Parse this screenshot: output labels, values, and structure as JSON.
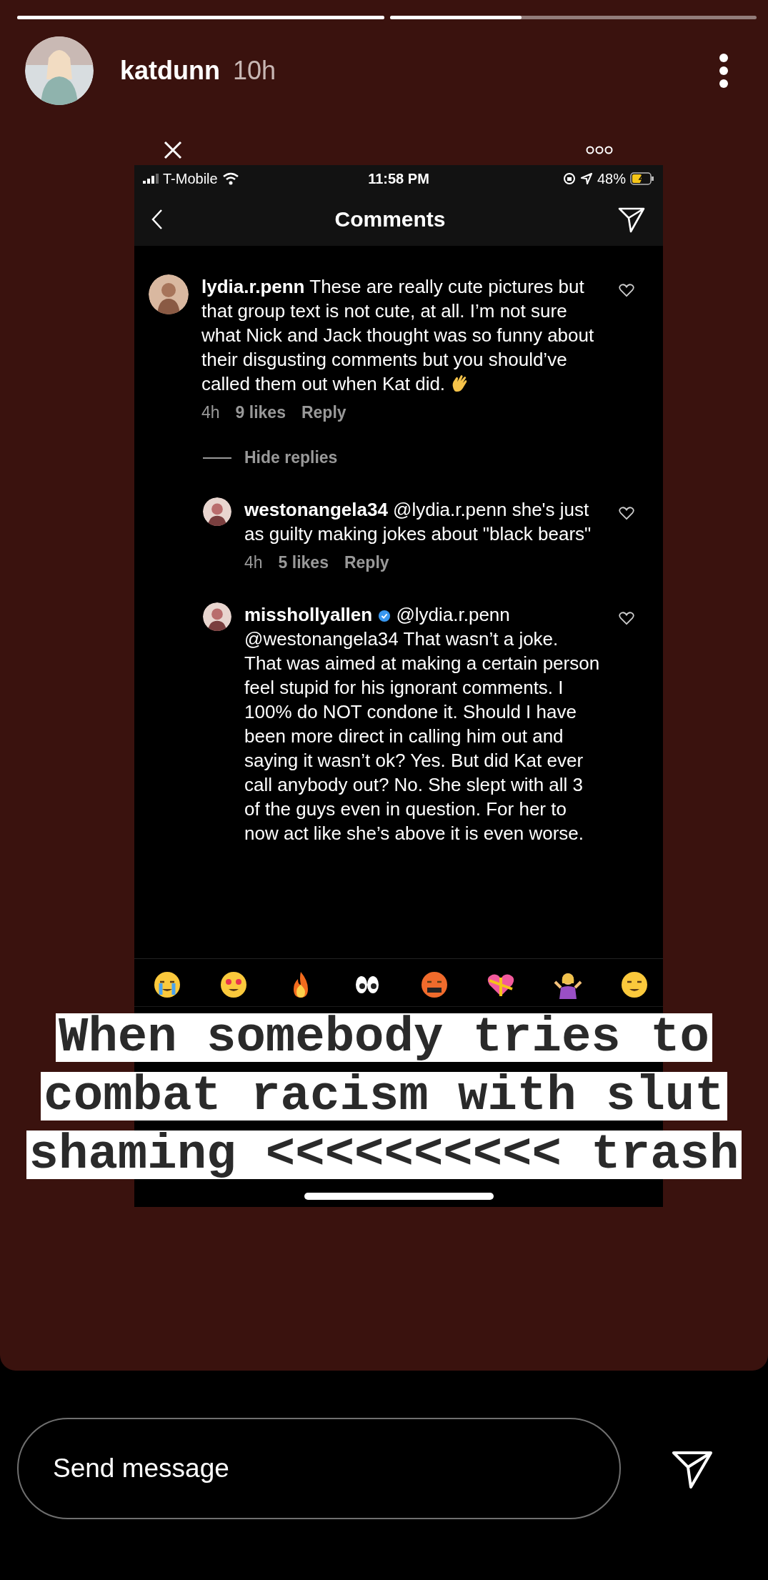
{
  "progress": [
    {
      "level": 1
    },
    {
      "level": 0.36
    }
  ],
  "header": {
    "username": "katdunn",
    "time": "10h"
  },
  "screenshot": {
    "status_bar": {
      "carrier": "T-Mobile",
      "time": "11:58 PM",
      "battery": "48%"
    },
    "title": "Comments",
    "comments": [
      {
        "username": "lydia.r.penn",
        "verified": false,
        "text": "These are really cute pictures but that group text is not cute, at all. I’m not sure what Nick and Jack thought was so funny about their disgusting comments but you should’ve called them out when Kat did.",
        "ends_with_wave": true,
        "time": "4h",
        "likes": "9 likes",
        "reply": "Reply",
        "replies_toggle": "Hide replies",
        "replies": [
          {
            "username": "westonangela34",
            "verified": false,
            "text": "@lydia.r.penn she's just as guilty making jokes about \"black bears\"",
            "time": "4h",
            "likes": "5 likes",
            "reply": "Reply"
          },
          {
            "username": "misshollyallen",
            "verified": true,
            "text": "@lydia.r.penn @westonangela34 That wasn’t a joke. That was aimed at making a certain person feel stupid for his ignorant comments. I 100% do NOT condone it. Should I have been more direct in calling him out and saying it wasn’t ok? Yes. But did Kat ever call anybody out? No. She slept with all 3 of the guys even in question. For her to now act like she’s above it is even worse."
          }
        ]
      }
    ]
  },
  "caption": {
    "lines": [
      "When somebody tries to",
      "combat racism with slut",
      "shaming <<<<<<<<<< trash"
    ]
  },
  "message": {
    "placeholder": "Send message"
  }
}
